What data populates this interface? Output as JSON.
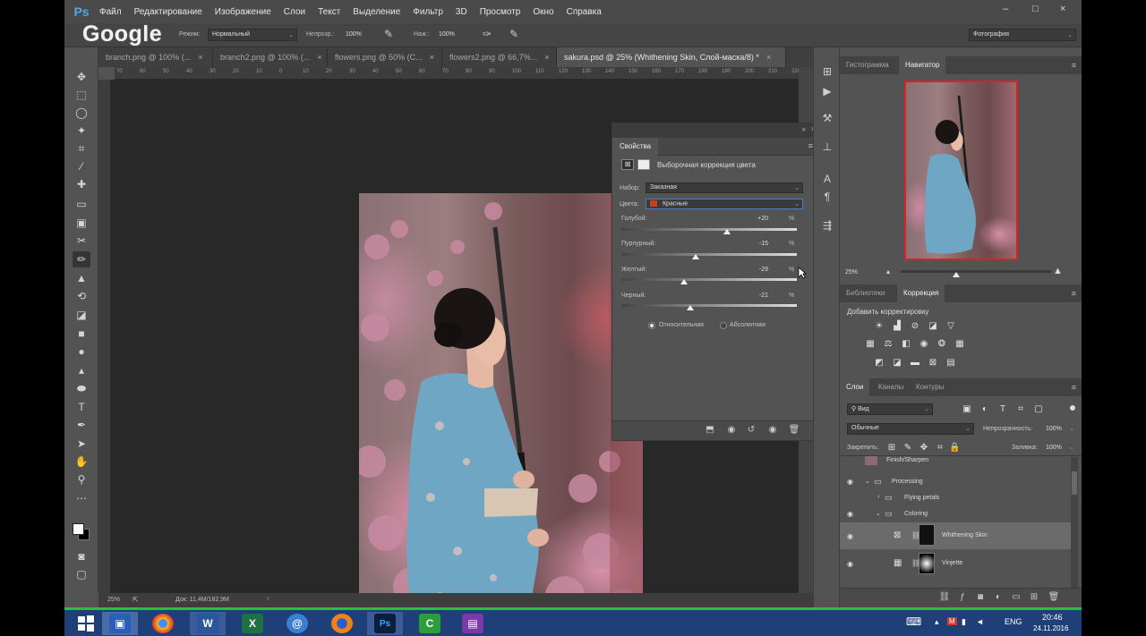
{
  "app": {
    "logo": "Ps",
    "menu": [
      "Файл",
      "Редактирование",
      "Изображение",
      "Слои",
      "Текст",
      "Выделение",
      "Фильтр",
      "3D",
      "Просмотр",
      "Окно",
      "Справка"
    ],
    "window_controls": [
      "–",
      "□",
      "×"
    ]
  },
  "overlay_logo": "Google",
  "options_bar": {
    "mode_label": "Режим:",
    "mode_value": "Нормальный",
    "opacity_label": "Непрозр.:",
    "opacity_value": "100%",
    "pressure_label": "Наж.:",
    "pressure_value": "100%",
    "workspace": "Фотография"
  },
  "tabs": [
    {
      "label": "branch.png @ 100% (...",
      "close": "×"
    },
    {
      "label": "branch2.png @ 100% (...",
      "close": "×"
    },
    {
      "label": "flowers.png @ 50% (C...",
      "close": "×"
    },
    {
      "label": "flowers2.png @ 66,7%...",
      "close": "×"
    },
    {
      "label": "sakura.psd @ 25% (Whithening Skin, Слой-маска/8) *",
      "close": "×"
    }
  ],
  "ruler_h": [
    "70",
    "60",
    "50",
    "40",
    "30",
    "20",
    "10",
    "0",
    "10",
    "20",
    "30",
    "40",
    "50",
    "60",
    "70",
    "80",
    "90",
    "100",
    "110",
    "120",
    "130",
    "140",
    "150",
    "160",
    "170",
    "180",
    "190",
    "200",
    "210",
    "220"
  ],
  "statusbar": {
    "zoom": "25%",
    "doc": "Док: 11,4M/182,9M",
    "arrow": "›"
  },
  "properties": {
    "tab": "Свойства",
    "title": "Выборочная коррекция цвета",
    "preset_label": "Набор:",
    "preset_value": "Заказная",
    "colors_label": "Цвета:",
    "colors_value": "Красные",
    "colors_swatch": "#d23a1c",
    "sliders": [
      {
        "label": "Голубой:",
        "value": "+20",
        "pct": "%",
        "level": 0.6
      },
      {
        "label": "Пурпурный:",
        "value": "-15",
        "pct": "%",
        "level": 0.425
      },
      {
        "label": "Желтый:",
        "value": "-29",
        "pct": "%",
        "level": 0.355
      },
      {
        "label": "Черный:",
        "value": "-21",
        "pct": "%",
        "level": 0.395
      }
    ],
    "method_relative": "Относительная",
    "method_absolute": "Абсолютная"
  },
  "navigator": {
    "tab_histogram": "Гистограмма",
    "tab_navigator": "Навигатор",
    "zoom": "25%"
  },
  "adjustments": {
    "tab_libraries": "Библиотеки",
    "tab_adjustments": "Коррекция",
    "add_label": "Добавить корректировку"
  },
  "layers": {
    "tab_layers": "Слои",
    "tab_channels": "Каналы",
    "tab_paths": "Контуры",
    "filter": "Вид",
    "blend_mode": "Обычные",
    "opacity_label": "Непрозрачность:",
    "opacity_value": "100%",
    "lock_label": "Закрепить:",
    "fill_label": "Заливка:",
    "fill_value": "100%",
    "items": [
      {
        "name": "Finish/Sharpen"
      },
      {
        "name": "Processing"
      },
      {
        "name": "Flying petals"
      },
      {
        "name": "Coloring"
      },
      {
        "name": "Whithening Skin"
      },
      {
        "name": "Vinjette"
      }
    ]
  },
  "taskbar": {
    "lang": "ENG",
    "time": "20:46",
    "date": "24.11.2016"
  }
}
